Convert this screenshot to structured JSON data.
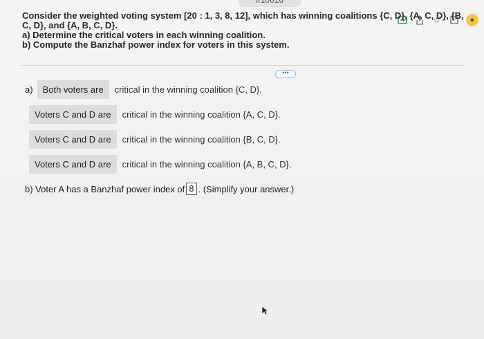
{
  "url_fragment": "#10016",
  "toolbar": {
    "icons": [
      "open-in-app-icon",
      "share-icon",
      "bookmark-star-icon",
      "window-icon",
      "profile-avatar-icon"
    ]
  },
  "question": {
    "line1": "Consider the weighted voting system [20 : 1, 3, 8, 12], which has winning coalitions {C, D}, {A, C, D}, {B, C, D}, and {A, B, C, D}.",
    "line2": "a) Determine the critical voters in each winning coalition.",
    "line3": "b) Compute the Banzhaf power index for voters in this system."
  },
  "more_label": "•••",
  "answers": {
    "part_a_label": "a)",
    "row1_chip": "Both voters are",
    "row1_text": "critical in the winning coalition {C, D}.",
    "row2_chip": "Voters C and D are",
    "row2_text": "critical in the winning coalition {A, C, D}.",
    "row3_chip": "Voters C and D are",
    "row3_text": "critical in the winning coalition {B, C, D}.",
    "row4_chip": "Voters C and D are",
    "row4_text": "critical in the winning coalition {A, B, C, D}.",
    "part_b_prefix": "b) Voter A has a Banzhaf power index of",
    "part_b_value": "8",
    "part_b_suffix": ". (Simplify your answer.)"
  }
}
